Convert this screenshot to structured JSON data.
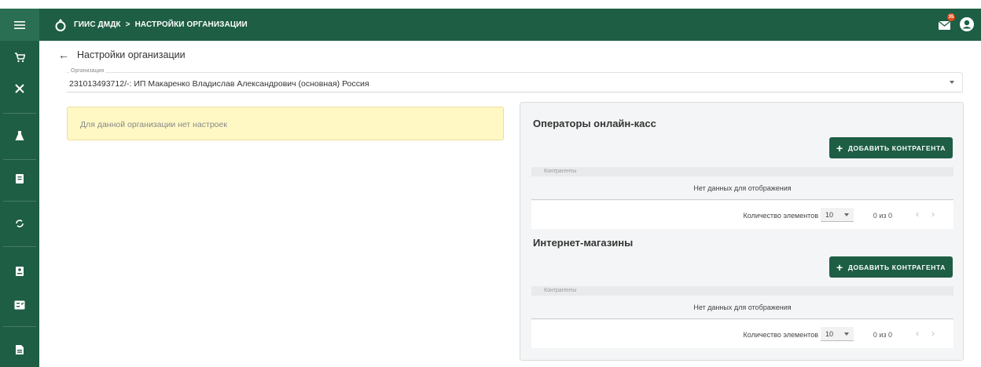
{
  "header": {
    "breadcrumb_root": "ГИИС ДМДК",
    "breadcrumb_sep": ">",
    "breadcrumb_current": "НАСТРОЙКИ ОРГАНИЗАЦИИ",
    "mail_badge": "35",
    "brand_color": "#1e5e45"
  },
  "page": {
    "back_arrow": "←",
    "title": "Настройки организации"
  },
  "organization": {
    "label": "Организация",
    "value": "231013493712/-: ИП Макаренко Владислав Александрович (основная) Россия"
  },
  "warning": {
    "text": "Для данной организации нет настроек"
  },
  "sections": [
    {
      "title": "Операторы онлайн-касс",
      "add_plus": "+",
      "add_label": "ДОБАВИТЬ КОНТРАГЕНТА",
      "table_header": "Контрагенты",
      "empty_text": "Нет данных для отображения",
      "pager_label": "Количество элементов",
      "pager_size": "10",
      "pager_count": "0 из 0",
      "prev": "‹",
      "next": "›"
    },
    {
      "title": "Интернет-магазины",
      "add_plus": "+",
      "add_label": "ДОБАВИТЬ КОНТРАГЕНТА",
      "table_header": "Контрагенты",
      "empty_text": "Нет данных для отображения",
      "pager_label": "Количество элементов",
      "pager_size": "10",
      "pager_count": "0 из 0",
      "prev": "‹",
      "next": "›"
    }
  ],
  "sidebar": {
    "icons": [
      "menu-icon",
      "cart-icon",
      "tools-icon",
      "flask-icon",
      "clipboard-icon",
      "sync-icon",
      "id-card-icon",
      "list-check-icon",
      "document-icon"
    ]
  }
}
